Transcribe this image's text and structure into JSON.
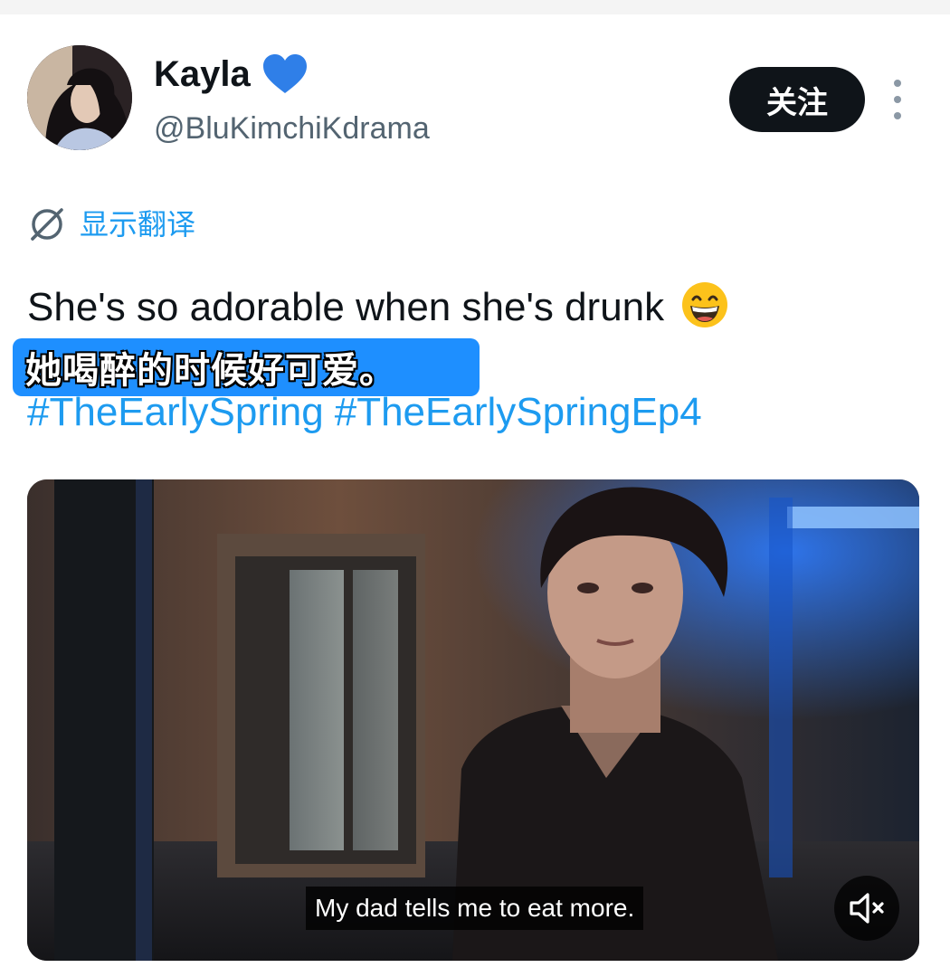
{
  "post": {
    "author": {
      "name": "Kayla",
      "name_emoji": "blue-heart-icon",
      "handle": "@BluKimchiKdrama"
    },
    "follow_label": "关注",
    "more_icon": "more-vertical-icon",
    "translate": {
      "icon": "translate-globe-icon",
      "label": "显示翻译"
    },
    "text": "She's so adorable when she's drunk",
    "text_emoji": "grinning-face-icon",
    "translation_overlay": "她喝醉的时候好可爱。",
    "hashtags": [
      "#TheEarlySpring",
      "#TheEarlySpringEp4"
    ]
  },
  "media": {
    "subtitle": "My dad tells me to eat more.",
    "mute_icon": "volume-muted-icon"
  },
  "colors": {
    "accent": "#1d9bf0",
    "follow_bg": "#0f1419",
    "secondary_text": "#536471",
    "overlay_blue": "#1e8fff"
  }
}
